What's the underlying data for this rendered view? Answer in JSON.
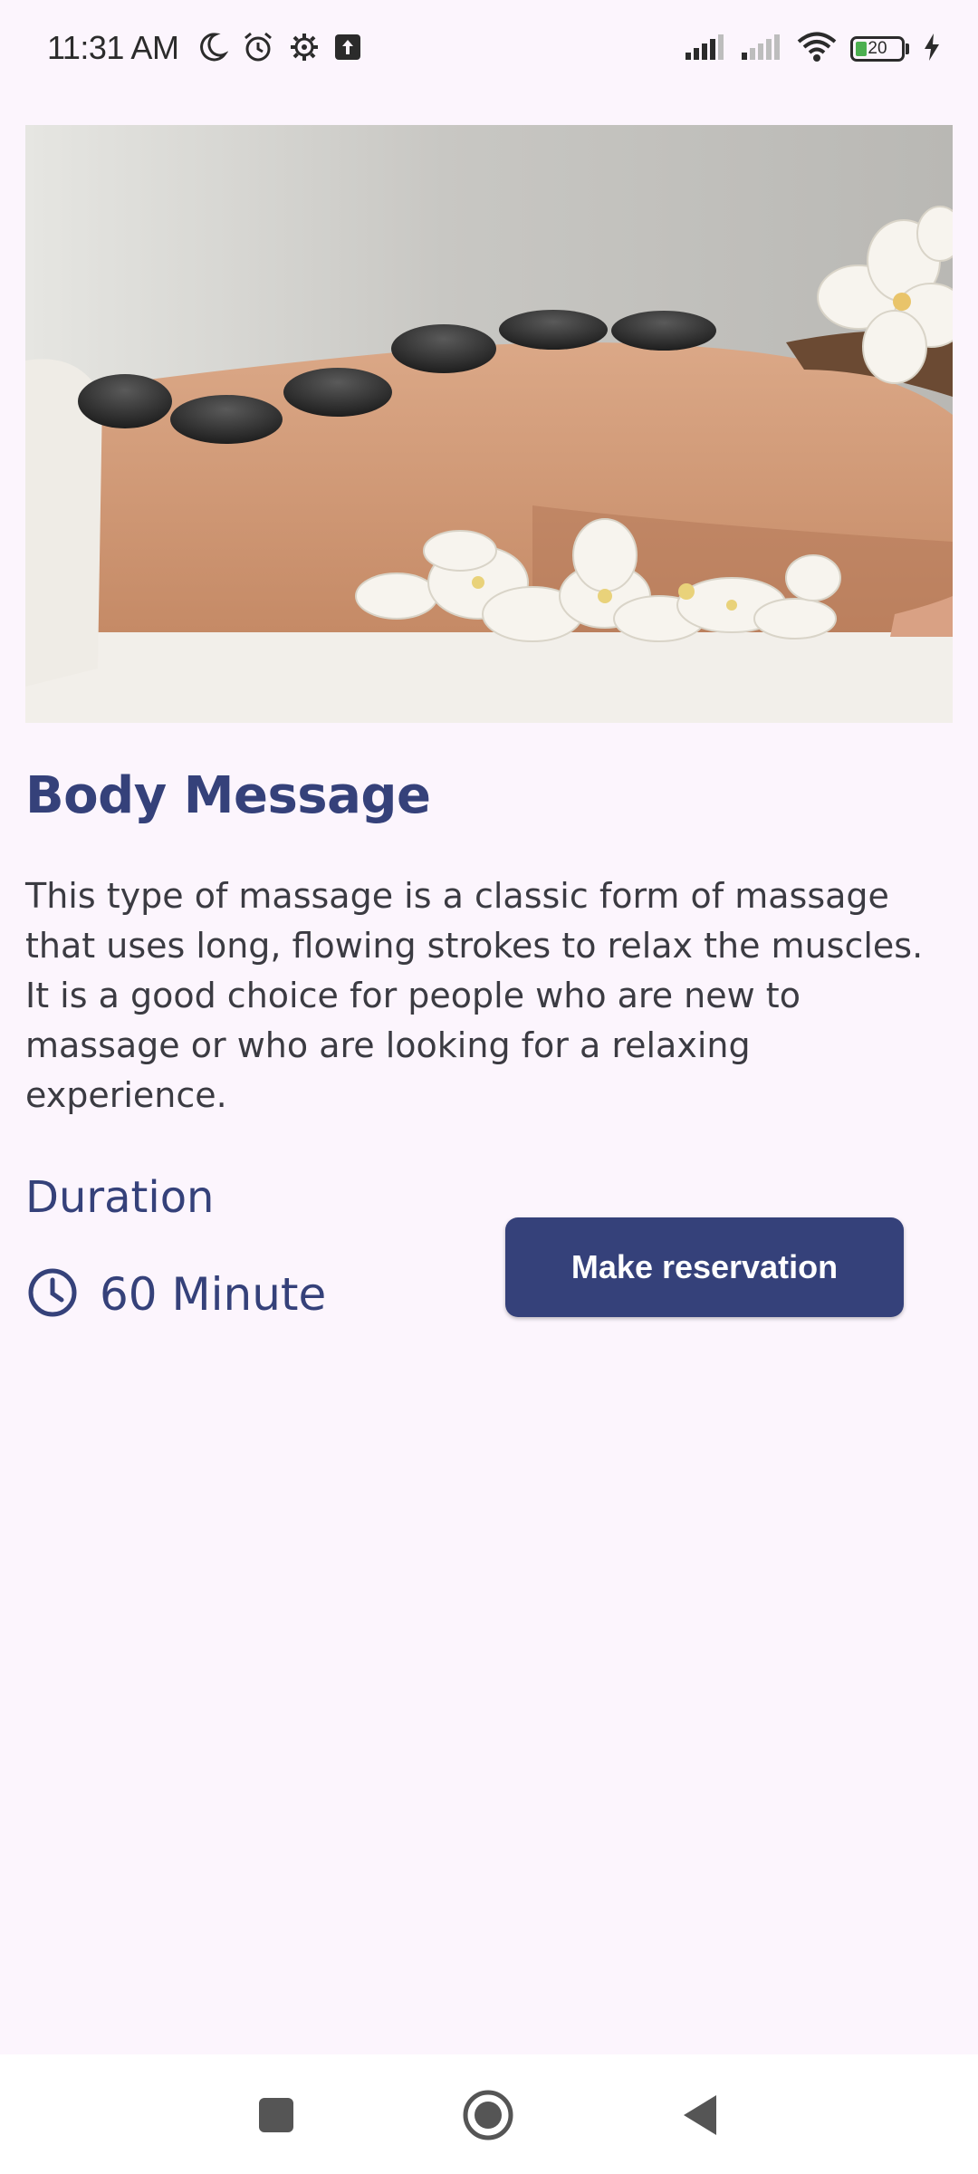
{
  "status_bar": {
    "time": "11:31 AM",
    "battery_level": "20",
    "icons": [
      "moon-icon",
      "alarm-icon",
      "settings-gear-icon",
      "upload-icon",
      "signal-icon",
      "signal-icon",
      "wifi-icon",
      "battery-icon",
      "charging-icon"
    ]
  },
  "service": {
    "title": "Body Message",
    "description": "This type of massage is a classic form of massage that uses long, flowing strokes to relax the muscles. It is a good choice for people who are new to massage or who are looking for a relaxing experience.",
    "duration_label": "Duration",
    "duration_value": "60 Minute",
    "reserve_label": "Make reservation"
  },
  "colors": {
    "accent": "#35417a",
    "background": "#fcf5fd",
    "text": "#3b3b42"
  },
  "nav_bar": {
    "buttons": [
      "recents-square-icon",
      "home-circle-icon",
      "back-triangle-icon"
    ]
  }
}
